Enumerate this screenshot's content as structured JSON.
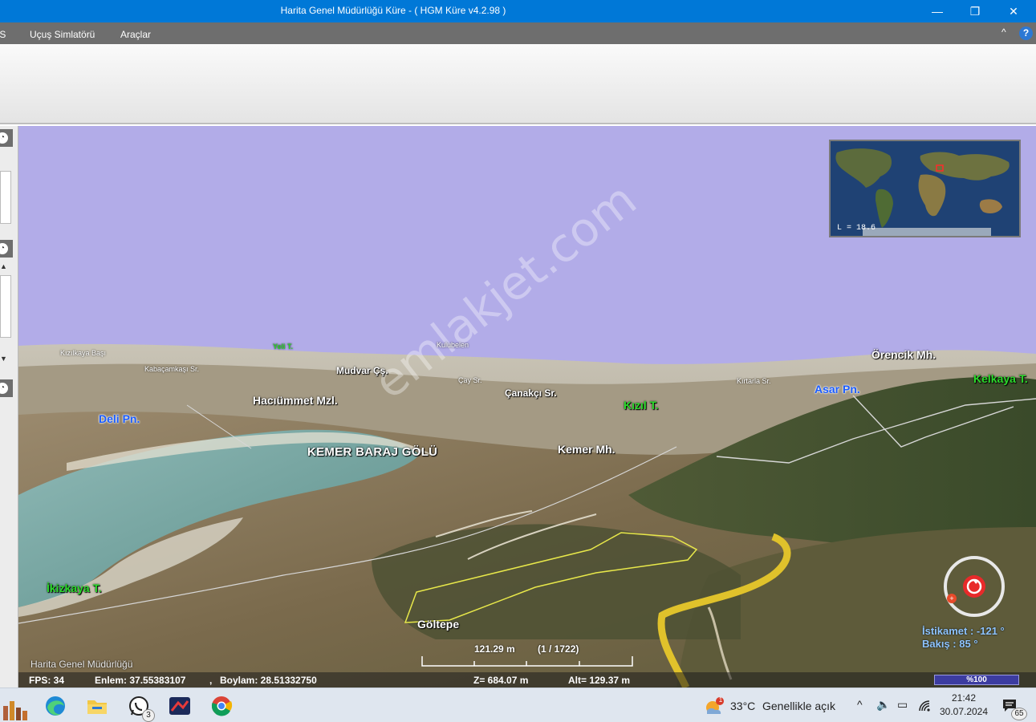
{
  "window": {
    "title": "Harita Genel Müdürlüğü Küre -  ( HGM Küre v4.2.98 )",
    "minimize": "—",
    "maximize": "❐",
    "close": "✕"
  },
  "menu": {
    "items": [
      "İS",
      "Uçuş Simlatörü",
      "Araçlar"
    ],
    "collapse_glyph": "^",
    "help_glyph": "?"
  },
  "map": {
    "watermark": "emlakjet.com",
    "labels": {
      "kizilkaya_basi": "Kızılkaya Başı",
      "kabacamkasi": "Kabaçamkaşı Sr.",
      "yeli_t": "Yeli T.",
      "kulubelen": "Kulubelen",
      "mudvar": "Mudvar Çş.",
      "cay_sr": "Çay Sr.",
      "canakci": "Çanakçı Sr.",
      "kirtarla": "Kırtarla Sr.",
      "orencik": "Örencik Mh.",
      "kelkaya": "Kelkaya T.",
      "haciummet": "Hacıümmet Mzl.",
      "deli_pn": "Deli Pn.",
      "kizil_t": "Kızıl T.",
      "asar_pn": "Asar Pn.",
      "kemer_baraj": "KEMER BARAJ GÖLÜ",
      "kemer_mh": "Kemer Mh.",
      "ikizkaya": "İkizkaya T.",
      "goltepe": "Göltepe"
    },
    "minimap_scale": "L = 18.6",
    "compass": {
      "heading": "İstikamet : -121 °",
      "tilt": "Bakış : 85 °"
    },
    "scale": {
      "distance": "121.29 m",
      "ratio": "(1 / 1722)"
    },
    "credit": "Harita Genel Müdürlüğü",
    "status": {
      "fps": "FPS: 34",
      "lat": "Enlem: 37.55383107",
      "sep": ",",
      "lon": "Boylam: 28.51332750",
      "z": "Z= 684.07 m",
      "alt": "Alt= 129.37 m",
      "zoom": "%100"
    }
  },
  "taskbar": {
    "whatsapp_badge": "3",
    "weather_alert": "1",
    "temperature": "33°C",
    "condition": "Genellikle açık",
    "tray_up": "^",
    "volume": "🔈",
    "battery": "▭",
    "time": "21:42",
    "date": "30.07.2024",
    "notifications": "65"
  },
  "colors": {
    "titlebar": "#0078d7",
    "sky": "#b2ace8",
    "parcel_outline": "#e8e84a",
    "road": "#e0c22b"
  }
}
